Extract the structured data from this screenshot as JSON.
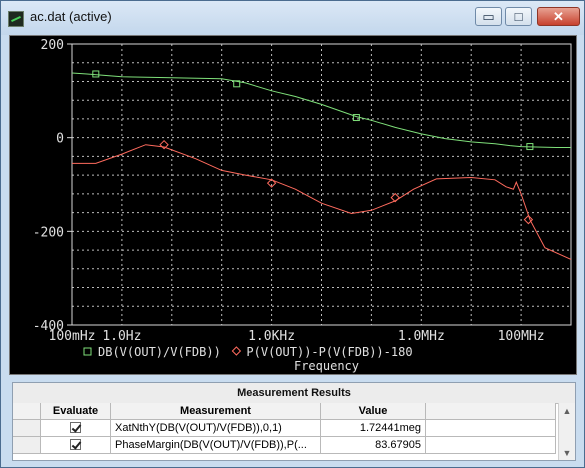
{
  "window": {
    "title": "ac.dat (active)",
    "buttons": {
      "minimize": "▭",
      "maximize": "□",
      "close": "✕"
    }
  },
  "chart_data": {
    "type": "line",
    "x_scale": "log",
    "xlim": [
      0.1,
      1000000000
    ],
    "ylim": [
      -400,
      200
    ],
    "x_ticks": [
      {
        "value": 0.1,
        "label": "100mHz"
      },
      {
        "value": 1,
        "label": "1.0Hz"
      },
      {
        "value": 1000,
        "label": "1.0KHz"
      },
      {
        "value": 1000000,
        "label": "1.0MHz"
      },
      {
        "value": 100000000,
        "label": "100MHz"
      }
    ],
    "y_ticks": [
      {
        "value": 200,
        "label": "200"
      },
      {
        "value": 0,
        "label": "0"
      },
      {
        "value": -200,
        "label": "-200"
      },
      {
        "value": -400,
        "label": "-400"
      }
    ],
    "xlabel": "Frequency",
    "grid": true,
    "series": [
      {
        "name": "DB(V(OUT)/V(FDB))",
        "color": "#7fe07a",
        "marker": "square",
        "x": [
          0.1,
          0.2,
          1,
          10,
          100,
          300,
          1000,
          3000,
          10000,
          50000,
          100000,
          300000,
          1000000,
          3000000,
          10000000,
          30000000,
          60000000,
          100000000,
          200000000,
          500000000,
          1000000000
        ],
        "y": [
          138,
          136,
          130,
          128,
          126,
          117,
          100,
          88,
          71,
          45,
          37,
          22,
          8,
          -2,
          -9,
          -13,
          -17,
          -19,
          -20,
          -21,
          -21
        ]
      },
      {
        "name": "P(V(OUT))-P(V(FDB))-180",
        "color": "#ff6b5e",
        "marker": "diamond",
        "x": [
          0.1,
          0.3,
          1,
          3,
          7,
          30,
          100,
          300,
          1000,
          3000,
          10000,
          40000,
          100000,
          300000,
          700000,
          2000000,
          10000000,
          30000000,
          50000000,
          70000000,
          80000000,
          100000000,
          150000000,
          300000000,
          1000000000
        ],
        "y": [
          -55,
          -55,
          -35,
          -15,
          -20,
          -45,
          -70,
          -80,
          -90,
          -110,
          -140,
          -162,
          -155,
          -135,
          -110,
          -88,
          -85,
          -90,
          -105,
          -110,
          -95,
          -120,
          -175,
          -235,
          -260
        ]
      }
    ],
    "markers": [
      {
        "series": 0,
        "x": 0.3,
        "y": 136
      },
      {
        "series": 0,
        "x": 200,
        "y": 115
      },
      {
        "series": 0,
        "x": 50000,
        "y": 43
      },
      {
        "series": 0,
        "x": 150000000,
        "y": -19
      },
      {
        "series": 1,
        "x": 7,
        "y": -15
      },
      {
        "series": 1,
        "x": 1000,
        "y": -97
      },
      {
        "series": 1,
        "x": 300000,
        "y": -128
      },
      {
        "series": 1,
        "x": 140000000,
        "y": -175
      }
    ]
  },
  "measurement_results": {
    "title": "Measurement Results",
    "columns": [
      "Evaluate",
      "Measurement",
      "Value"
    ],
    "rows": [
      {
        "evaluate": true,
        "measurement": "XatNthY(DB(V(OUT)/V(FDB)),0,1)",
        "value": "1.72441meg"
      },
      {
        "evaluate": true,
        "measurement": "PhaseMargin(DB(V(OUT)/V(FDB)),P(...",
        "value": "83.67905"
      }
    ]
  }
}
